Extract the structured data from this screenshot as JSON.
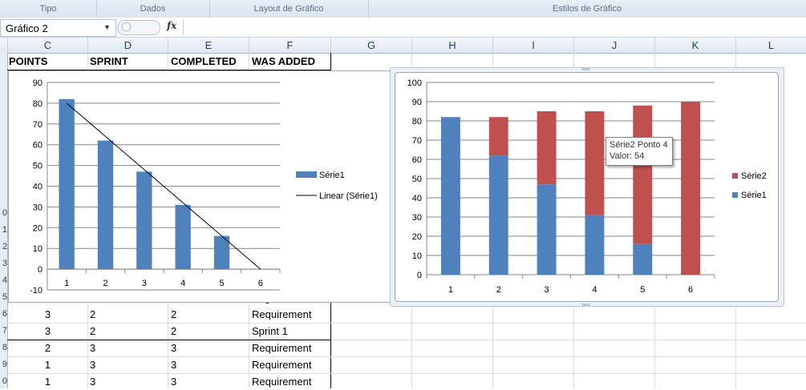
{
  "ribbon": {
    "groups": [
      "Tipo",
      "Dados",
      "Layout de Gráfico",
      "Estilos de Gráfico"
    ]
  },
  "formula_bar": {
    "name_box": "Gráfico 2",
    "fx_label": "fx",
    "formula": ""
  },
  "columns": [
    "C",
    "D",
    "E",
    "F",
    "G",
    "H",
    "I",
    "J",
    "K",
    "L"
  ],
  "row_numbers": [
    "0",
    "1",
    "2",
    "3",
    "4",
    "5",
    "6",
    "7",
    "8",
    "9",
    "0"
  ],
  "sheet": {
    "headers": [
      "POINTS",
      "SPRINT",
      "COMPLETED",
      "WAS ADDED"
    ],
    "rows": [
      [
        "3",
        "2",
        "2",
        "Requirement"
      ],
      [
        "3",
        "2",
        "2",
        "Sprint 1"
      ],
      [
        "2",
        "3",
        "3",
        "Requirement"
      ],
      [
        "1",
        "3",
        "3",
        "Requirement"
      ],
      [
        "1",
        "3",
        "3",
        "Requirement"
      ]
    ],
    "partial_cell": "3"
  },
  "colors": {
    "serie1": "#4f81bd",
    "serie2": "#c0504d",
    "grid": "#878787"
  },
  "chart_data": [
    {
      "type": "bar",
      "categories": [
        "1",
        "2",
        "3",
        "4",
        "5",
        "6"
      ],
      "series": [
        {
          "name": "Série1",
          "values": [
            82,
            62,
            47,
            31,
            16,
            0
          ]
        }
      ],
      "trendline": {
        "name": "Linear (Série1)",
        "type": "linear",
        "start": [
          1,
          80
        ],
        "end": [
          6,
          0
        ]
      },
      "ylim": [
        -10,
        90
      ],
      "yticks": [
        -10,
        0,
        10,
        20,
        30,
        40,
        50,
        60,
        70,
        80,
        90
      ],
      "grid": true,
      "legend": "right",
      "legend_entries": [
        "Série1",
        "Linear (Série1)"
      ]
    },
    {
      "type": "bar",
      "stacked": true,
      "categories": [
        "1",
        "2",
        "3",
        "4",
        "5",
        "6"
      ],
      "series": [
        {
          "name": "Série1",
          "values": [
            82,
            62,
            47,
            31,
            16,
            0
          ]
        },
        {
          "name": "Série2",
          "values": [
            0,
            20,
            38,
            54,
            72,
            90
          ]
        }
      ],
      "ylim": [
        0,
        100
      ],
      "yticks": [
        0,
        10,
        20,
        30,
        40,
        50,
        60,
        70,
        80,
        90,
        100
      ],
      "grid": true,
      "legend": "right",
      "legend_entries": [
        "Série2",
        "Série1"
      ],
      "tooltip": {
        "line1": "Série2 Ponto 4",
        "line2": "Valor: 54"
      }
    }
  ]
}
